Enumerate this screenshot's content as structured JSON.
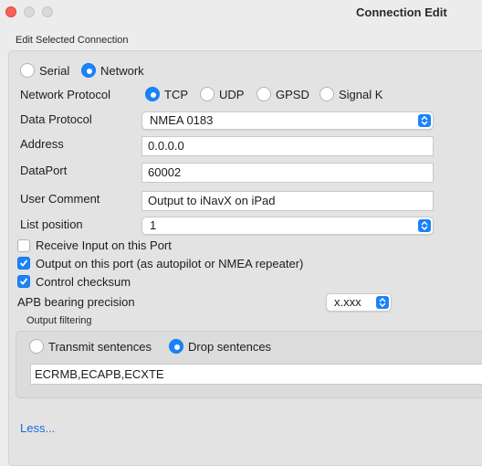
{
  "window": {
    "title": "Connection Edit"
  },
  "section_label": "Edit Selected Connection",
  "source_type": {
    "serial_label": "Serial",
    "network_label": "Network",
    "selected": "Network"
  },
  "network_protocol": {
    "label": "Network Protocol",
    "options": [
      "TCP",
      "UDP",
      "GPSD",
      "Signal K"
    ],
    "selected": "TCP"
  },
  "data_protocol": {
    "label": "Data Protocol",
    "value": "NMEA 0183"
  },
  "address": {
    "label": "Address",
    "value": "0.0.0.0"
  },
  "data_port": {
    "label": "DataPort",
    "value": "60002"
  },
  "user_comment": {
    "label": "User Comment",
    "value": "Output to iNavX on iPad"
  },
  "list_position": {
    "label": "List position",
    "value": "1"
  },
  "checkboxes": {
    "receive_input": {
      "label": "Receive Input on this Port",
      "checked": false
    },
    "output_port": {
      "label": "Output on this port (as autopilot or NMEA repeater)",
      "checked": true
    },
    "control_checksum": {
      "label": "Control checksum",
      "checked": true
    }
  },
  "apb_precision": {
    "label": "APB bearing precision",
    "value": "x.xxx"
  },
  "output_filtering": {
    "label": "Output filtering",
    "transmit_label": "Transmit sentences",
    "drop_label": "Drop sentences",
    "selected": "Drop sentences",
    "sentences": "ECRMB,ECAPB,ECXTE"
  },
  "less_link": "Less...",
  "colors": {
    "accent": "#1a82fb",
    "link": "#1a6ae6",
    "close": "#fe5f57"
  }
}
